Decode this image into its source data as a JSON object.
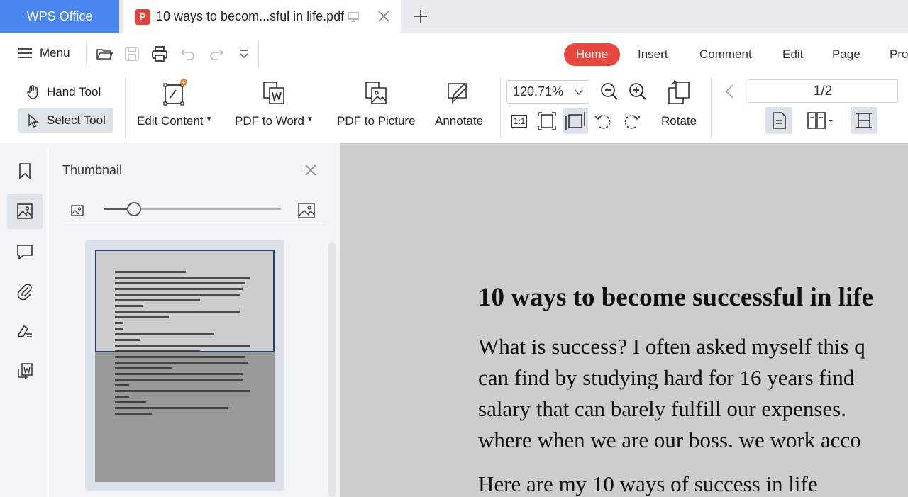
{
  "titlebar": {
    "app_tab": "WPS Office",
    "doc_tab": "10 ways to becom...sful in life.pdf",
    "doc_badge": "P"
  },
  "menubar": {
    "menu_label": "Menu",
    "tabs": [
      "Home",
      "Insert",
      "Comment",
      "Edit",
      "Page",
      "Pro"
    ],
    "active_tab": "Home"
  },
  "ribbon": {
    "hand_tool": "Hand Tool",
    "select_tool": "Select Tool",
    "edit_content": "Edit Content",
    "pdf_to_word": "PDF to Word",
    "pdf_to_picture": "PDF to Picture",
    "annotate": "Annotate",
    "zoom": "120.71%",
    "actual_size": "1:1",
    "rotate": "Rotate",
    "page_indicator": "1/2"
  },
  "thumbnail_panel": {
    "title": "Thumbnail",
    "slider_level": 0.17
  },
  "document": {
    "title": "10 ways to become successful in life",
    "paragraph1": [
      "What is success? I often asked myself this q",
      "can find by studying hard for 16 years find",
      "salary that can barely fulfill our expenses.",
      "where when we are our boss. we work acco"
    ],
    "paragraph2": "Here are my 10 ways of success in life"
  },
  "colors": {
    "app_tab_blue": "#4a86f0",
    "home_tab_red": "#e9483f",
    "pdf_badge_red": "#e0443e",
    "doc_background": "#cdcdcd"
  }
}
